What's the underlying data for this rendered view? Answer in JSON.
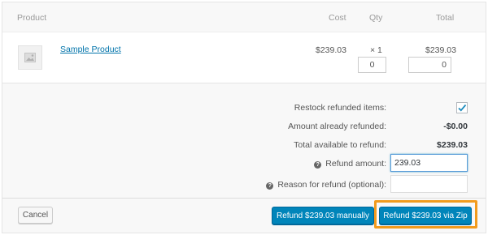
{
  "header": {
    "product": "Product",
    "cost": "Cost",
    "qty": "Qty",
    "total": "Total"
  },
  "item": {
    "name": "Sample Product",
    "cost": "$239.03",
    "qty": "× 1",
    "total": "$239.03",
    "refund_qty_value": "0",
    "refund_total_value": "0",
    "thumbnail_icon": "image-placeholder-icon"
  },
  "summary": {
    "restock_label": "Restock refunded items:",
    "restock_checked": true,
    "already_refunded_label": "Amount already refunded:",
    "already_refunded_value": "-$0.00",
    "available_label": "Total available to refund:",
    "available_value": "$239.03",
    "refund_amount_label": "Refund amount:",
    "refund_amount_value": "239.03",
    "reason_label": "Reason for refund (optional):",
    "reason_value": ""
  },
  "actions": {
    "cancel_label": "Cancel",
    "manual_label": "Refund $239.03 manually",
    "zip_label": "Refund $239.03 via Zip"
  },
  "colors": {
    "primary": "#0085ba",
    "highlight": "#f29b1d",
    "link": "#0073aa"
  }
}
